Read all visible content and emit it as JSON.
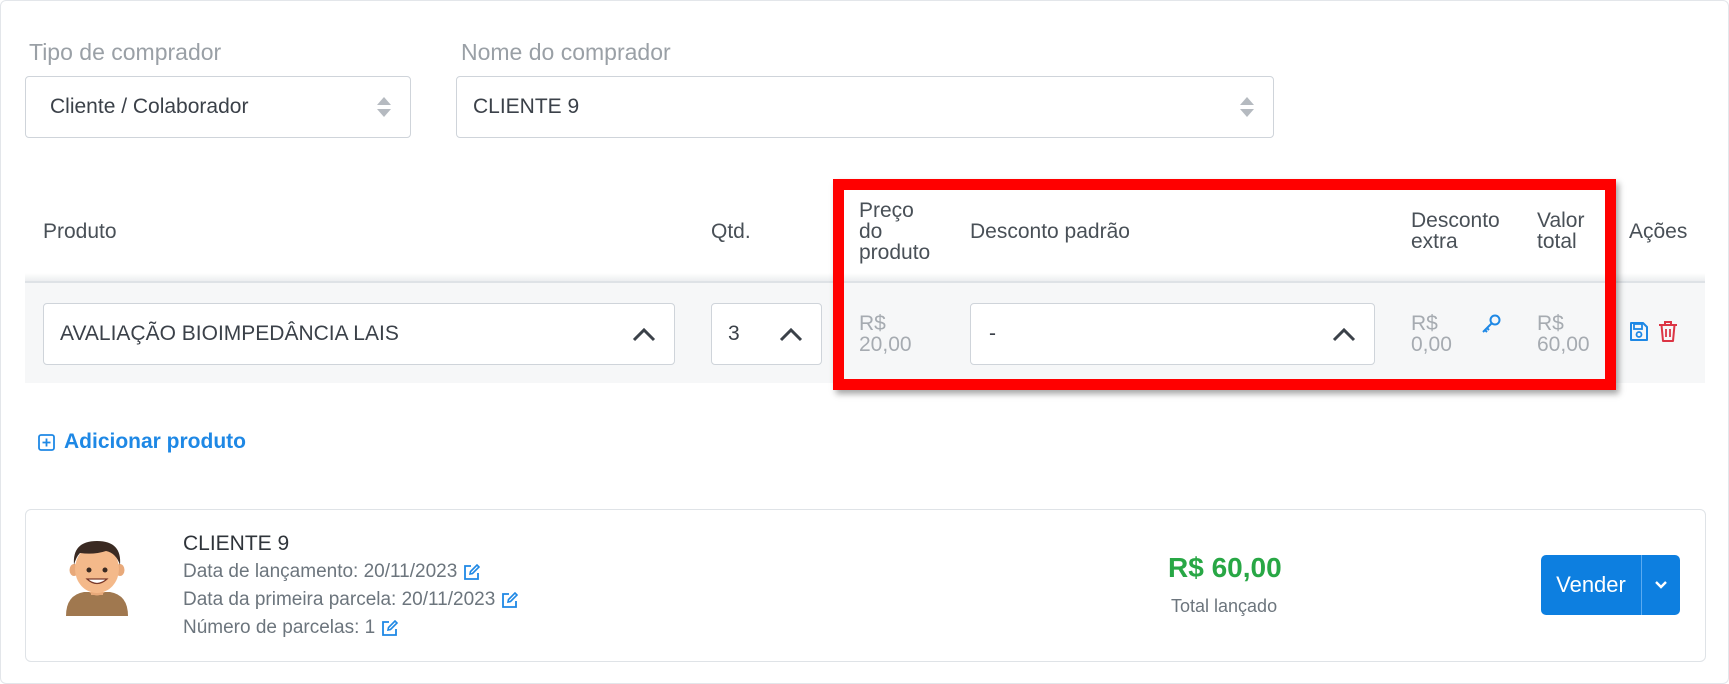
{
  "buyer_type": {
    "label": "Tipo de comprador",
    "value": "Cliente / Colaborador"
  },
  "buyer_name": {
    "label": "Nome do comprador",
    "value": "CLIENTE 9"
  },
  "table": {
    "headers": {
      "produto": "Produto",
      "qtd": "Qtd.",
      "preco_l1": "Preço",
      "preco_l2": "do",
      "preco_l3": "produto",
      "desconto_padrao": "Desconto padrão",
      "desconto_extra_l1": "Desconto",
      "desconto_extra_l2": "extra",
      "valor_total_l1": "Valor",
      "valor_total_l2": "total",
      "acoes": "Ações"
    },
    "row": {
      "produto": "AVALIAÇÃO BIOIMPEDÂNCIA LAIS",
      "qtd": "3",
      "preco_currency": "R$",
      "preco_value": "20,00",
      "desconto_padrao": "-",
      "desconto_extra_currency": "R$",
      "desconto_extra_value": "0,00",
      "valor_total_currency": "R$",
      "valor_total_value": "60,00"
    }
  },
  "add_product": "Adicionar produto",
  "summary": {
    "client_name": "CLIENTE 9",
    "launch_date": "Data de lançamento: 20/11/2023",
    "first_installment_date": "Data da primeira parcela: 20/11/2023",
    "installments": "Número de parcelas: 1",
    "total_value": "R$ 60,00",
    "total_label": "Total lançado",
    "sell_button": "Vender"
  },
  "colors": {
    "accent": "#1e88e5",
    "button": "#0d7fe0",
    "total_green": "#28a745",
    "highlight": "#ff0000",
    "delete": "#dc3545"
  }
}
